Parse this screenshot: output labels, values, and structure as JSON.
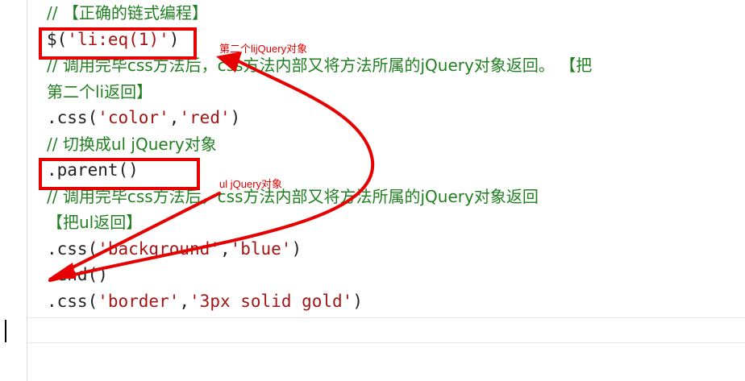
{
  "editor": {
    "lines": [
      {
        "comment": "// 【正确的链式编程】"
      },
      {
        "code": "$('li:eq(1)')"
      },
      {
        "comment": "// 调用完毕css方法后，css方法内部又将方法所属的jQuery对象返回。 【把"
      },
      {
        "comment": "第二个li返回】"
      },
      {
        "code": ".css('color','red')"
      },
      {
        "comment": "// 切换成ul jQuery对象"
      },
      {
        "code": ".parent()"
      },
      {
        "comment": "// 调用完毕css方法后，css方法内部又将方法所属的jQuery对象返回"
      },
      {
        "comment": "【把ul返回】"
      },
      {
        "code": ".css('background','blue')"
      },
      {
        "code": ".end()"
      },
      {
        "code": ".css('border','3px solid gold')"
      }
    ]
  },
  "annotations": {
    "label1": "第二个lijQuery对象",
    "label2": "ul jQuery对象",
    "color": "#e60000"
  }
}
